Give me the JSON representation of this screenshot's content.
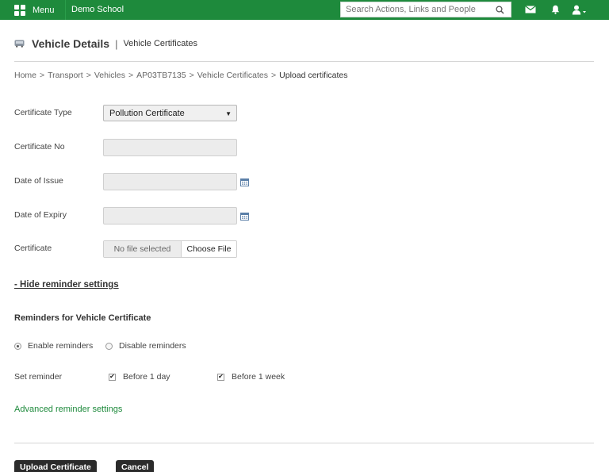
{
  "topbar": {
    "menu_label": "Menu",
    "school_name": "Demo School",
    "search_placeholder": "Search Actions, Links and People",
    "brand_color": "#1e8a3c"
  },
  "header": {
    "title": "Vehicle Details",
    "separator": "|",
    "subtitle": "Vehicle Certificates"
  },
  "breadcrumb": [
    "Home",
    "Transport",
    "Vehicles",
    "AP03TB7135",
    "Vehicle Certificates",
    "Upload certificates"
  ],
  "breadcrumb_separator": ">",
  "form": {
    "certificate_type_label": "Certificate Type",
    "certificate_type_value": "Pollution Certificate",
    "certificate_no_label": "Certificate No",
    "certificate_no_value": "",
    "date_of_issue_label": "Date of Issue",
    "date_of_issue_value": "",
    "date_of_expiry_label": "Date of Expiry",
    "date_of_expiry_value": "",
    "certificate_label": "Certificate",
    "file_status": "No file selected",
    "file_button": "Choose File"
  },
  "reminders": {
    "toggle_link": "- Hide reminder settings",
    "heading": "Reminders for Vehicle Certificate",
    "enable_label": "Enable reminders",
    "disable_label": "Disable reminders",
    "enabled": true,
    "set_reminder_label": "Set reminder",
    "before_day_label": "Before 1 day",
    "before_day_checked": true,
    "before_week_label": "Before 1 week",
    "before_week_checked": true,
    "advanced_link": "Advanced reminder settings"
  },
  "actions": {
    "upload_label": "Upload Certificate",
    "cancel_label": "Cancel"
  }
}
